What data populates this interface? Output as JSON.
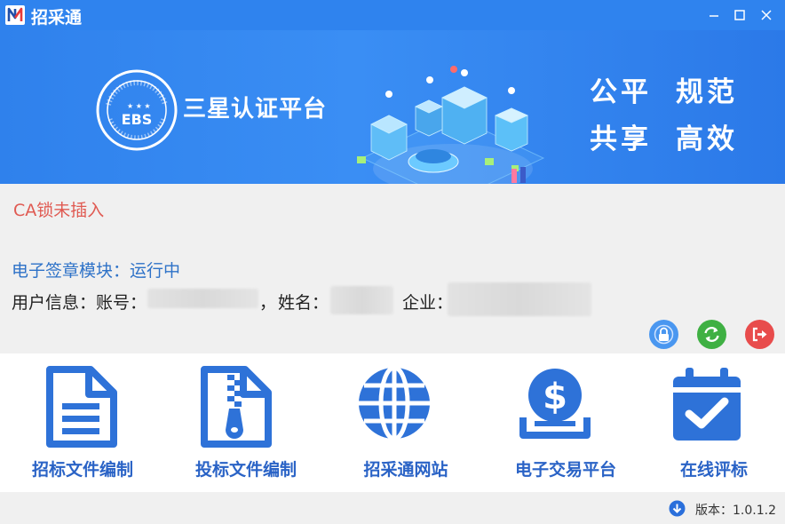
{
  "window": {
    "title": "招采通",
    "controls": [
      "minimize-icon",
      "maximize-icon",
      "close-icon"
    ]
  },
  "banner": {
    "logo_text": "EBS",
    "title": "三星认证平台",
    "slogan_line1_a": "公平",
    "slogan_line1_b": "规范",
    "slogan_line2_a": "共享",
    "slogan_line2_b": "高效"
  },
  "status": {
    "ca_lock": "CA锁未插入",
    "module_label": "电子签章模块：",
    "module_value": "运行中"
  },
  "user_info": {
    "label": "用户信息：",
    "account_label": "账号：",
    "separator": "，",
    "name_label": "姓名：",
    "company_label": "企业："
  },
  "action_buttons": [
    {
      "icon": "lock-icon",
      "color": "#4a97f0"
    },
    {
      "icon": "refresh-icon",
      "color": "#3fb043"
    },
    {
      "icon": "logout-icon",
      "color": "#e84c4c"
    }
  ],
  "tiles": [
    {
      "label": "招标文件编制",
      "icon": "document-icon"
    },
    {
      "label": "投标文件编制",
      "icon": "zip-file-icon"
    },
    {
      "label": "招采通网站",
      "icon": "globe-icon"
    },
    {
      "label": "电子交易平台",
      "icon": "dollar-coin-icon"
    },
    {
      "label": "在线评标",
      "icon": "calendar-check-icon"
    }
  ],
  "footer": {
    "version": "版本：1.0.1.2"
  },
  "colors": {
    "titlebar": "#2f83ee",
    "accent": "#2a6fdb",
    "tile_label": "#2a63c6",
    "ca_warning": "#e05a52",
    "module_status": "#2e72c8"
  }
}
